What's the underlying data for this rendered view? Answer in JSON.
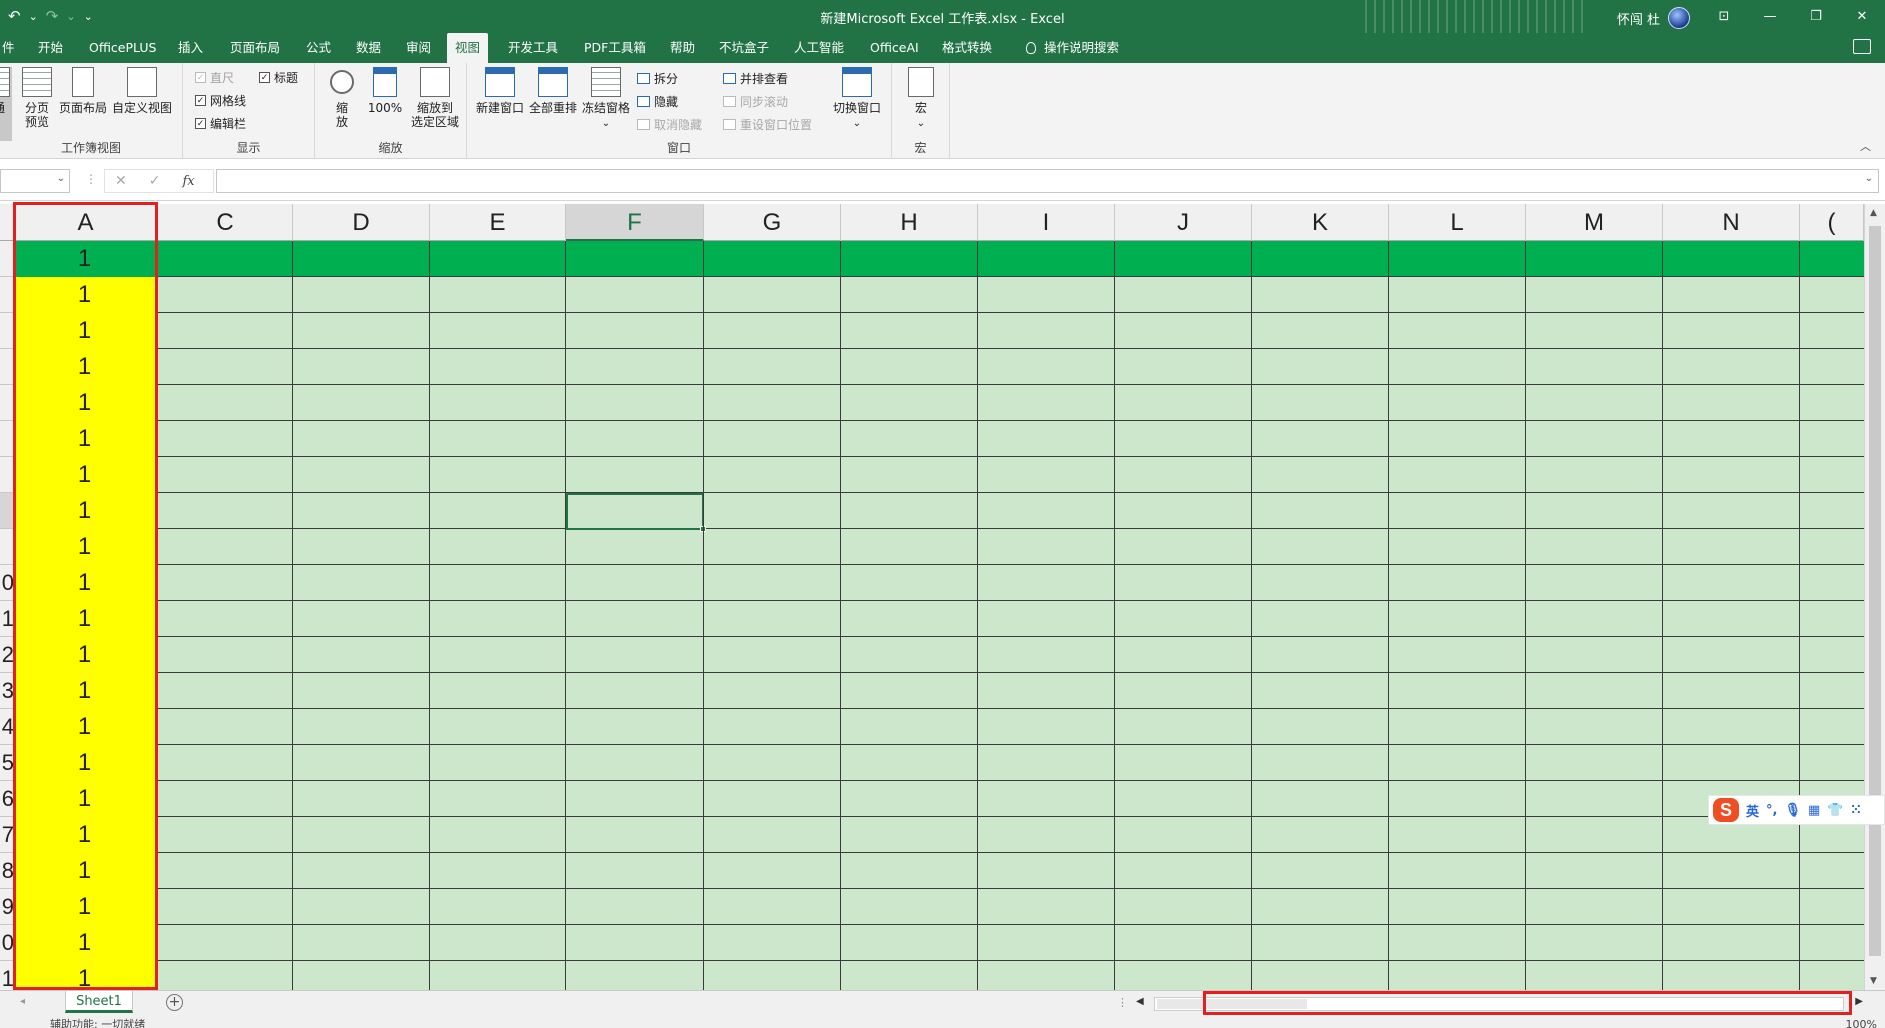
{
  "titlebar": {
    "title": "新建Microsoft Excel 工作表.xlsx  -  Excel",
    "user": "怀闯 杜",
    "undo": "↶",
    "undo_dd": "⌄",
    "redo": "↷",
    "redo_dd": "⌄",
    "qa_more": "⌄",
    "ribbon_options": "⊡",
    "minimize": "—",
    "restore": "❐",
    "close": "✕"
  },
  "tabs": [
    {
      "label": "件"
    },
    {
      "label": "开始"
    },
    {
      "label": "OfficePLUS"
    },
    {
      "label": "插入"
    },
    {
      "label": "页面布局"
    },
    {
      "label": "公式"
    },
    {
      "label": "数据"
    },
    {
      "label": "审阅"
    },
    {
      "label": "视图",
      "active": true
    },
    {
      "label": "开发工具"
    },
    {
      "label": "PDF工具箱"
    },
    {
      "label": "帮助"
    },
    {
      "label": "不坑盒子"
    },
    {
      "label": "人工智能"
    },
    {
      "label": "OfficeAI"
    },
    {
      "label": "格式转换"
    },
    {
      "label": "操作说明搜索"
    }
  ],
  "ribbon": {
    "workbook_views": {
      "label": "工作簿视图",
      "normal": "通",
      "page_break_1": "分页",
      "page_break_2": "预览",
      "page_layout": "页面布局",
      "custom_view": "自定义视图"
    },
    "show": {
      "label": "显示",
      "ruler": "直尺",
      "gridlines": "网格线",
      "formula_bar": "编辑栏",
      "headings": "标题",
      "check": "✓"
    },
    "zoom": {
      "label": "缩放",
      "zoom_1": "缩",
      "zoom_2": "放",
      "hundred": "100%",
      "zoom_sel_1": "缩放到",
      "zoom_sel_2": "选定区域"
    },
    "window": {
      "label": "窗口",
      "new_window": "新建窗口",
      "arrange_all": "全部重排",
      "freeze": "冻结窗格",
      "freeze_dd": "⌄",
      "split": "拆分",
      "hide": "隐藏",
      "unhide": "取消隐藏",
      "side_by_side": "并排查看",
      "sync_scroll": "同步滚动",
      "reset_pos": "重设窗口位置",
      "switch": "切换窗口",
      "switch_dd": "⌄"
    },
    "macros": {
      "label": "宏",
      "macro": "宏",
      "macro_dd": "⌄"
    },
    "collapse": "︿"
  },
  "formula_bar": {
    "name_box": "",
    "name_dd": "⌄",
    "dots": "⋮",
    "cancel": "✕",
    "enter": "✓",
    "fx": "fx",
    "value": "",
    "formula_dd": "⌄"
  },
  "columns": [
    {
      "label": "A"
    },
    {
      "label": "C"
    },
    {
      "label": "D"
    },
    {
      "label": "E"
    },
    {
      "label": "F",
      "selected": true
    },
    {
      "label": "G"
    },
    {
      "label": "H"
    },
    {
      "label": "I"
    },
    {
      "label": "J"
    },
    {
      "label": "K"
    },
    {
      "label": "L"
    },
    {
      "label": "M"
    },
    {
      "label": "N"
    },
    {
      "label": "("
    }
  ],
  "row_headers": [
    "",
    "",
    "",
    "",
    "",
    "",
    "",
    "",
    "",
    "0",
    "1",
    "2",
    "3",
    "4",
    "5",
    "6",
    "7",
    "8",
    "9",
    "0",
    "1"
  ],
  "cellA_values": [
    "1",
    "1",
    "1",
    "1",
    "1",
    "1",
    "1",
    "1",
    "1",
    "1",
    "1",
    "1",
    "1",
    "1",
    "1",
    "1",
    "1",
    "1",
    "1",
    "1",
    "1"
  ],
  "active_row_index": 7,
  "colors": {
    "header_row": "#00b050",
    "column_a_fill": "#ffff00",
    "cell_background": "#cde7cd",
    "accent": "#217346",
    "highlight_box": "#e32020"
  },
  "scroll": {
    "up": "▲",
    "down": "▼",
    "left": "◀",
    "right": "▶"
  },
  "sheets": {
    "nav": "◂",
    "tabs": [
      "Sheet1"
    ],
    "add": "+",
    "split": "⋮"
  },
  "ime": {
    "logo": "S",
    "lang": "英",
    "punct": "°,",
    "mic": "🎙",
    "keyboard": "▦",
    "skin": "👕",
    "tools": "⁙"
  },
  "status": {
    "accessibility": "辅助功能: 一切就绪",
    "zoom": "100%"
  }
}
